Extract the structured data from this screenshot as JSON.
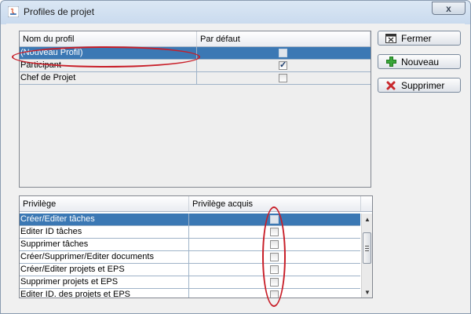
{
  "window": {
    "title": "Profiles de projet",
    "close_glyph": "x"
  },
  "profiles": {
    "columns": [
      "Nom du profil",
      "Par défaut"
    ],
    "rows": [
      {
        "name": "(Nouveau Profil)",
        "default": false,
        "selected": true
      },
      {
        "name": "Participant",
        "default": true,
        "selected": false
      },
      {
        "name": "Chef de Projet",
        "default": false,
        "selected": false
      }
    ]
  },
  "buttons": {
    "fermer": "Fermer",
    "nouveau": "Nouveau",
    "supprimer": "Supprimer"
  },
  "privileges": {
    "columns": [
      "Privilège",
      "Privilège acquis"
    ],
    "rows": [
      {
        "name": "Créer/Editer tâches",
        "acquired": false,
        "selected": true
      },
      {
        "name": "Editer ID tâches",
        "acquired": false,
        "selected": false
      },
      {
        "name": "Supprimer tâches",
        "acquired": false,
        "selected": false
      },
      {
        "name": "Créer/Supprimer/Editer documents",
        "acquired": false,
        "selected": false
      },
      {
        "name": "Créer/Editer projets et EPS",
        "acquired": false,
        "selected": false
      },
      {
        "name": "Supprimer projets et EPS",
        "acquired": false,
        "selected": false
      },
      {
        "name": "Editer ID. des projets et EPS",
        "acquired": false,
        "selected": false
      }
    ]
  },
  "icons": {
    "fermer": "close-window-icon",
    "nouveau": "plus-icon",
    "supprimer": "delete-icon",
    "app": "java-icon"
  },
  "colors": {
    "selection": "#3b78b4",
    "highlight": "#c81e28",
    "plus": "#3aa63a",
    "delete": "#c8282d"
  }
}
